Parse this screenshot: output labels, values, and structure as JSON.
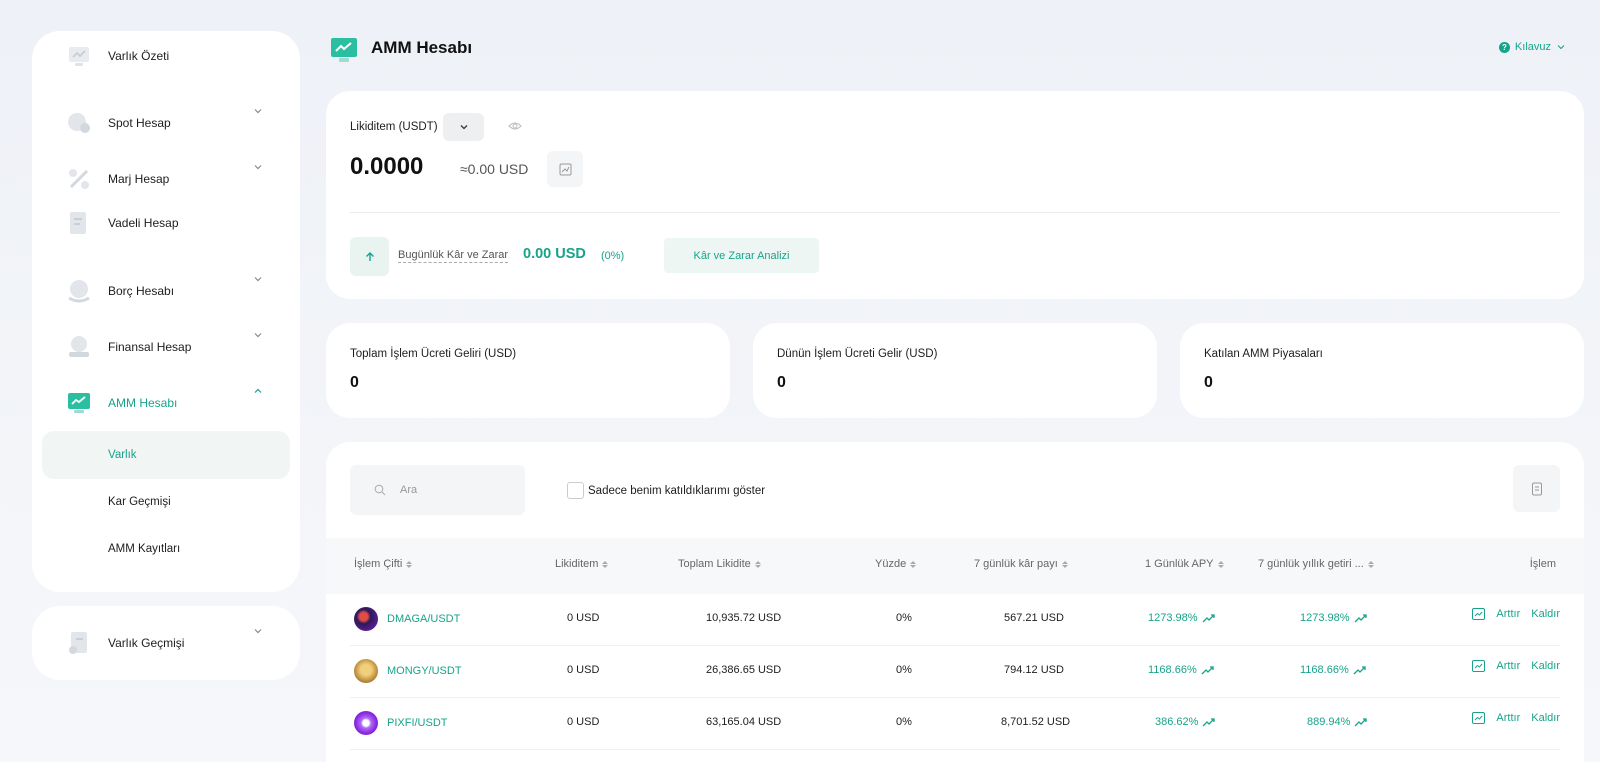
{
  "colors": {
    "accent": "#17a38a",
    "accent_light": "#e9f4f1",
    "text": "#1d1d1f",
    "muted": "#666666"
  },
  "sidebar": {
    "items": [
      {
        "label": "Varlık Özeti",
        "icon": "asset-overview-icon",
        "has_chevron": false,
        "expanded": false
      },
      {
        "label": "Spot Hesap",
        "icon": "spot-account-icon",
        "has_chevron": true,
        "expanded": false
      },
      {
        "label": "Marj Hesap",
        "icon": "margin-account-icon",
        "has_chevron": true,
        "expanded": false
      },
      {
        "label": "Vadeli Hesap",
        "icon": "futures-account-icon",
        "has_chevron": false,
        "expanded": false
      },
      {
        "label": "Borç Hesabı",
        "icon": "loan-account-icon",
        "has_chevron": true,
        "expanded": false
      },
      {
        "label": "Finansal Hesap",
        "icon": "finance-account-icon",
        "has_chevron": true,
        "expanded": false
      },
      {
        "label": "AMM Hesabı",
        "icon": "amm-account-icon",
        "has_chevron": true,
        "expanded": true,
        "active": true
      }
    ],
    "sub_items": [
      {
        "label": "Varlık",
        "active": true
      },
      {
        "label": "Kar Geçmişi",
        "active": false
      },
      {
        "label": "AMM Kayıtları",
        "active": false
      }
    ],
    "history": {
      "label": "Varlık Geçmişi",
      "icon": "asset-history-icon"
    }
  },
  "header": {
    "title": "AMM Hesabı",
    "guide_label": "Kılavuz"
  },
  "liquidity": {
    "label": "Likiditem (USDT)",
    "value": "0.0000",
    "approx": "≈0.00 USD",
    "pnl_label": "Bugünlük Kâr ve Zarar",
    "pnl_value": "0.00 USD",
    "pnl_percent": "(0%)",
    "analysis_button": "Kâr ve Zarar Analizi"
  },
  "stats": [
    {
      "label": "Toplam İşlem Ücreti Geliri (USD)",
      "value": "0"
    },
    {
      "label": "Dünün İşlem Ücreti Gelir (USD)",
      "value": "0"
    },
    {
      "label": "Katılan AMM Piyasaları",
      "value": "0"
    }
  ],
  "filters": {
    "search_placeholder": "Ara",
    "checkbox_label": "Sadece benim katıldıklarımı göster",
    "checkbox_checked": false
  },
  "table": {
    "headers": {
      "pair": "İşlem Çifti",
      "liquidity": "Likiditem",
      "total_liquidity": "Toplam Likidite",
      "percent": "Yüzde",
      "fee_7d": "7 günlük kâr payı",
      "apy_1d": "1 Günlük APY",
      "apy_7d": "7 günlük yıllık getiri ...",
      "action": "İşlem"
    },
    "rows": [
      {
        "pair": "DMAGA/USDT",
        "coin_color": "#7a1fbf",
        "liquidity": "0 USD",
        "total_liquidity": "10,935.72 USD",
        "percent": "0%",
        "fee_7d": "567.21 USD",
        "apy_1d": "1273.98%",
        "apy_7d": "1273.98%",
        "add": "Arttır",
        "remove": "Kaldır"
      },
      {
        "pair": "MONGY/USDT",
        "coin_color": "#b88a3c",
        "liquidity": "0 USD",
        "total_liquidity": "26,386.65 USD",
        "percent": "0%",
        "fee_7d": "794.12 USD",
        "apy_1d": "1168.66%",
        "apy_7d": "1168.66%",
        "add": "Arttır",
        "remove": "Kaldır"
      },
      {
        "pair": "PIXFI/USDT",
        "coin_color": "#8a2be2",
        "liquidity": "0 USD",
        "total_liquidity": "63,165.04 USD",
        "percent": "0%",
        "fee_7d": "8,701.52 USD",
        "apy_1d": "386.62%",
        "apy_7d": "889.94%",
        "add": "Arttır",
        "remove": "Kaldır"
      }
    ]
  }
}
